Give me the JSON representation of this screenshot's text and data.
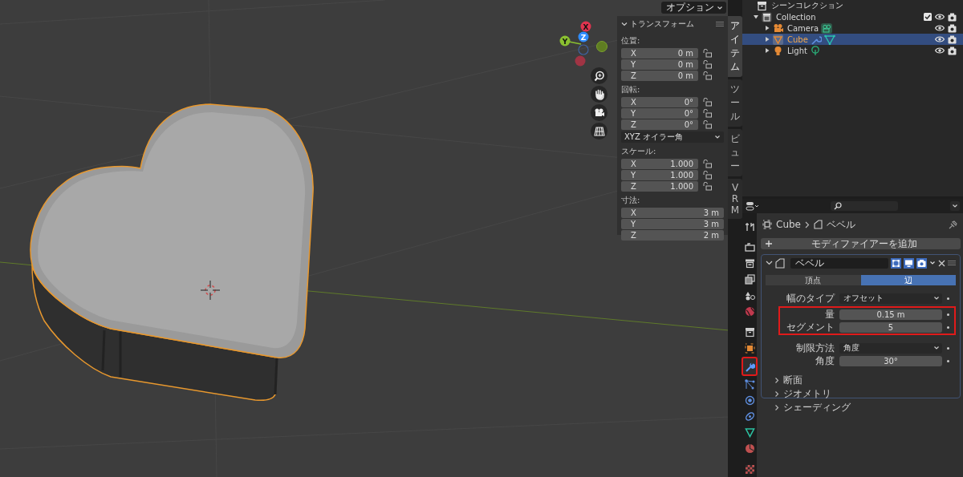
{
  "viewport": {
    "options_button": "オプション",
    "gizmo": {
      "x_label": "X",
      "y_label": "Y",
      "z_label": "Z"
    },
    "transform_panel": {
      "title": "トランスフォーム",
      "groups": [
        {
          "label": "位置:",
          "fields": [
            {
              "axis": "X",
              "value": "0 m",
              "locked": false
            },
            {
              "axis": "Y",
              "value": "0 m",
              "locked": false
            },
            {
              "axis": "Z",
              "value": "0 m",
              "locked": false
            }
          ]
        },
        {
          "label": "回転:",
          "fields": [
            {
              "axis": "X",
              "value": "0°",
              "locked": false
            },
            {
              "axis": "Y",
              "value": "0°",
              "locked": false
            },
            {
              "axis": "Z",
              "value": "0°",
              "locked": false
            }
          ],
          "dropdown": "XYZ オイラー角"
        },
        {
          "label": "スケール:",
          "fields": [
            {
              "axis": "X",
              "value": "1.000",
              "locked": false
            },
            {
              "axis": "Y",
              "value": "1.000",
              "locked": false
            },
            {
              "axis": "Z",
              "value": "1.000",
              "locked": false
            }
          ]
        },
        {
          "label": "寸法:",
          "fields": [
            {
              "axis": "X",
              "value": "3 m"
            },
            {
              "axis": "Y",
              "value": "3 m"
            },
            {
              "axis": "Z",
              "value": "2 m"
            }
          ]
        }
      ]
    },
    "sidebar_tabs": [
      {
        "label": "アイテム",
        "selected": true
      },
      {
        "label": "ツール",
        "selected": false
      },
      {
        "label": "ビュー",
        "selected": false
      },
      {
        "label": "VRM",
        "selected": false
      }
    ]
  },
  "outliner": {
    "root": {
      "label": "シーンコレクション",
      "children": [
        {
          "label": "Collection",
          "kind": "collection",
          "expanded": true,
          "checked": true,
          "selected": false,
          "children": [
            {
              "label": "Camera",
              "kind": "camera",
              "expanded": false,
              "selected": false,
              "has_modifier": false
            },
            {
              "label": "Cube",
              "kind": "mesh",
              "expanded": false,
              "selected": true,
              "has_modifier": true
            },
            {
              "label": "Light",
              "kind": "light",
              "expanded": false,
              "selected": false,
              "has_modifier": false
            }
          ]
        }
      ]
    }
  },
  "properties": {
    "tabs": [
      {
        "kind": "tool",
        "selected": false,
        "highlighted": false
      },
      {
        "kind": "render",
        "selected": false,
        "highlighted": false
      },
      {
        "kind": "output",
        "selected": false,
        "highlighted": false
      },
      {
        "kind": "view_layer",
        "selected": false,
        "highlighted": false
      },
      {
        "kind": "scene",
        "selected": false,
        "highlighted": false
      },
      {
        "kind": "world",
        "selected": false,
        "highlighted": false
      },
      {
        "kind": "collection",
        "selected": false,
        "highlighted": false
      },
      {
        "kind": "object",
        "selected": false,
        "highlighted": false
      },
      {
        "kind": "modifier",
        "selected": true,
        "highlighted": true
      },
      {
        "kind": "particles",
        "selected": false,
        "highlighted": false
      },
      {
        "kind": "physics",
        "selected": false,
        "highlighted": false
      },
      {
        "kind": "constraints",
        "selected": false,
        "highlighted": false
      },
      {
        "kind": "data",
        "selected": false,
        "highlighted": false
      },
      {
        "kind": "material",
        "selected": false,
        "highlighted": false
      },
      {
        "kind": "texture",
        "selected": false,
        "highlighted": false
      }
    ],
    "breadcrumb": [
      "Cube",
      "ベベル"
    ],
    "add_button": "モディファイアーを追加",
    "modifier": {
      "name": "ベベル",
      "expanded": true,
      "toggles": [
        {
          "kind": "edit_mode",
          "on": true
        },
        {
          "kind": "viewport",
          "on": true
        },
        {
          "kind": "render",
          "on": true
        }
      ],
      "modes": [
        {
          "label": "頂点",
          "selected": false
        },
        {
          "label": "辺",
          "selected": true
        }
      ],
      "fields": [
        {
          "label": "幅のタイプ",
          "kind": "dropdown",
          "value": "オフセット",
          "highlighted": false
        },
        {
          "label": "量",
          "kind": "number",
          "value": "0.15 m",
          "highlighted": true
        },
        {
          "label": "セグメント",
          "kind": "number",
          "value": "5",
          "highlighted": true
        },
        {
          "label": "制限方法",
          "kind": "dropdown",
          "value": "角度",
          "highlighted": false
        },
        {
          "label": "角度",
          "kind": "number",
          "value": "30°",
          "highlighted": false
        }
      ],
      "subpanels": [
        {
          "label": "断面",
          "expanded": false
        },
        {
          "label": "ジオメトリ",
          "expanded": false
        },
        {
          "label": "シェーディング",
          "expanded": false
        }
      ]
    }
  }
}
